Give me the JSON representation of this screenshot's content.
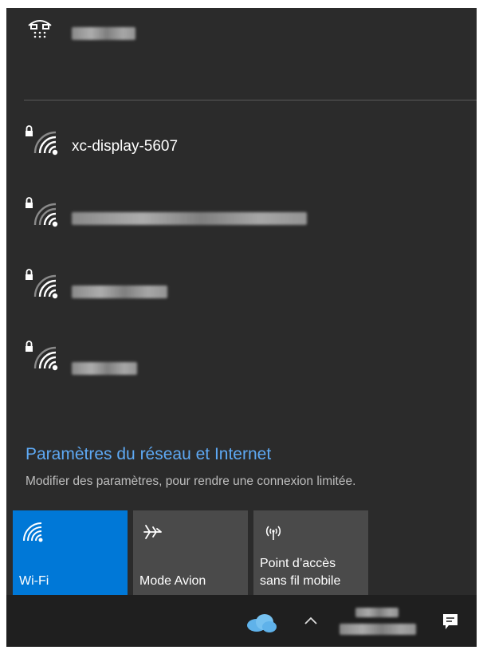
{
  "network_list": {
    "wired": {
      "icon": "ethernet-icon"
    },
    "wifi_networks": [
      {
        "name": "xc-display-5607",
        "icon": "wifi-secured-icon"
      },
      {
        "name": "",
        "icon": "wifi-secured-icon"
      },
      {
        "name": "",
        "icon": "wifi-secured-icon"
      },
      {
        "name": "",
        "icon": "wifi-secured-icon"
      }
    ]
  },
  "settings": {
    "link_label": "Paramètres du réseau et Internet",
    "description": "Modifier des paramètres, pour rendre une connexion limitée."
  },
  "quick_actions": [
    {
      "label": "Wi-Fi",
      "icon": "wifi-icon",
      "active": true
    },
    {
      "label": "Mode Avion",
      "icon": "airplane-icon",
      "active": false
    },
    {
      "label": "Point d’accès sans fil mobile",
      "icon": "hotspot-icon",
      "active": false
    }
  ],
  "taskbar": {
    "icons": [
      "onedrive-cloud-icon",
      "chevron-up-icon",
      "notifications-icon"
    ]
  },
  "colors": {
    "flyout_bg": "#2b2b2b",
    "accent": "#0078d7",
    "link": "#5ea9f4",
    "taskbar_bg": "#1f1f1f"
  }
}
